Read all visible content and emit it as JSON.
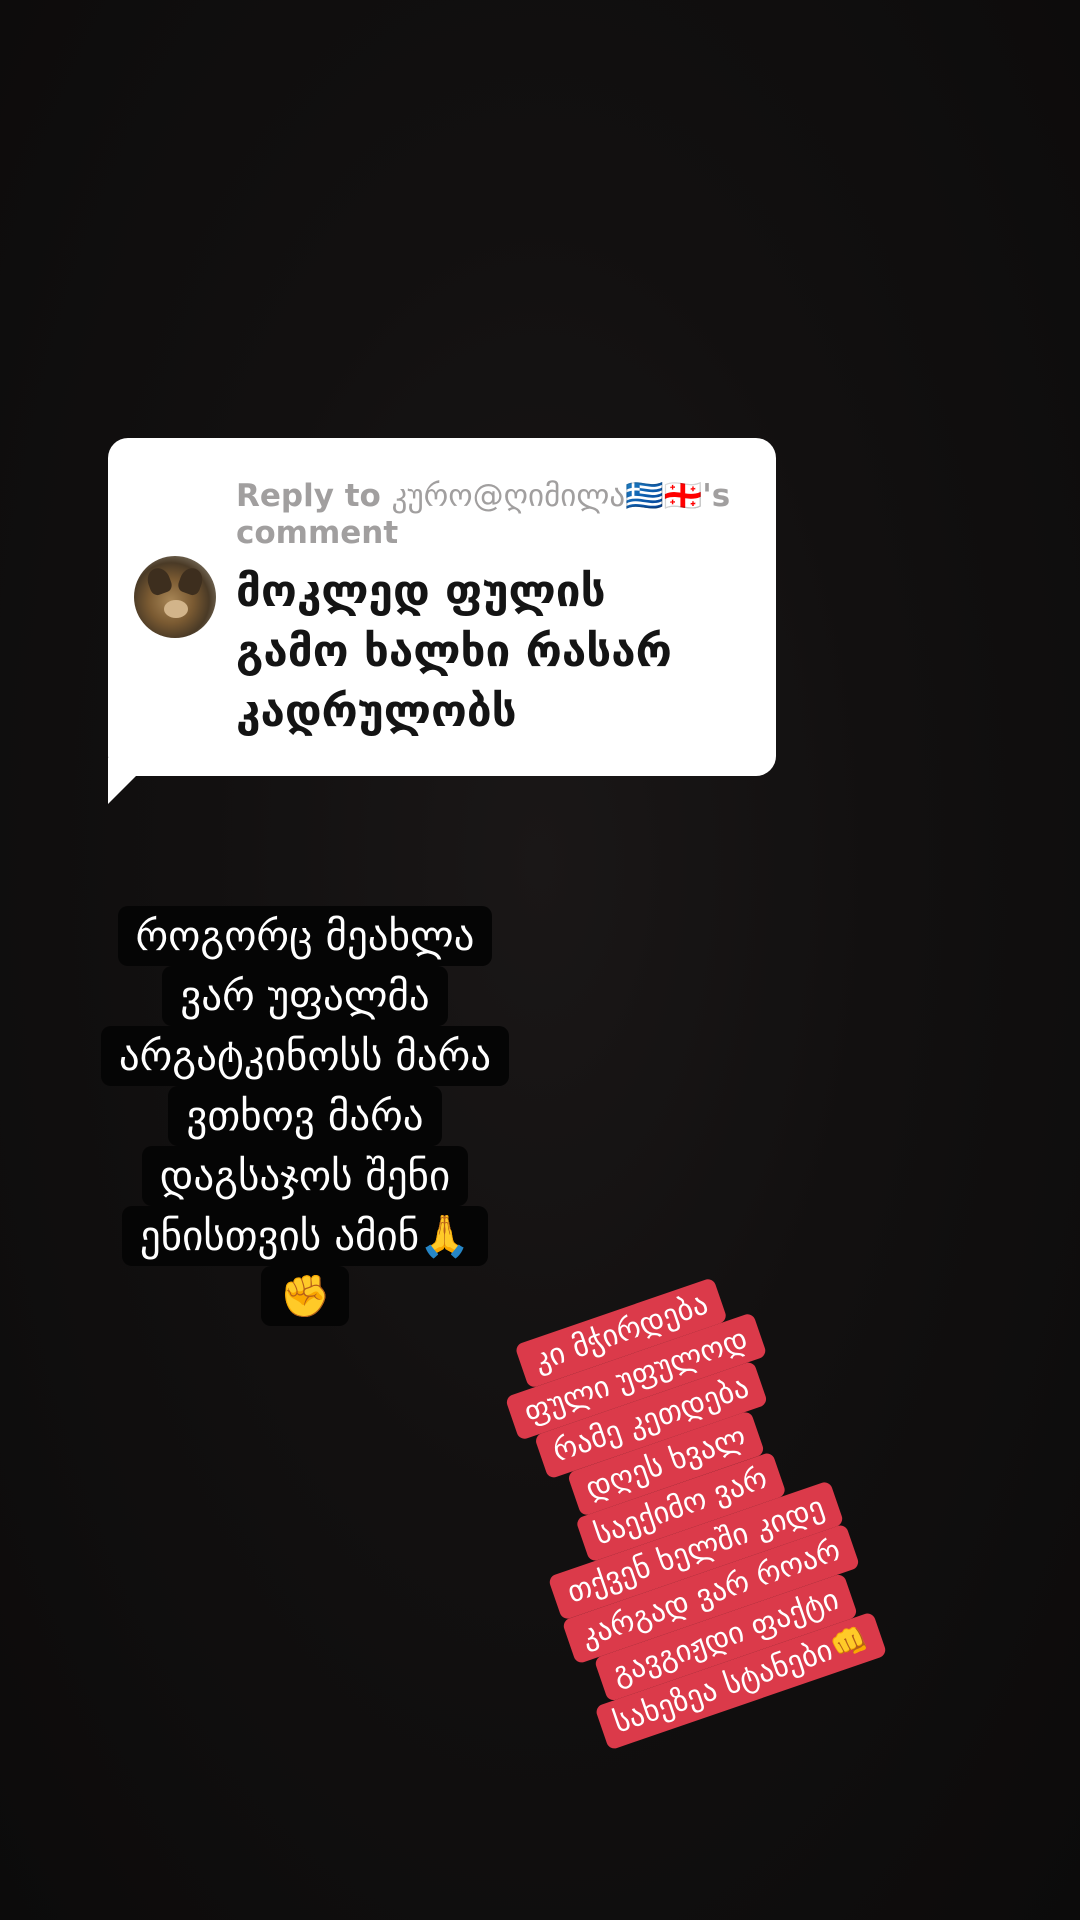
{
  "reply": {
    "prefix": "Reply to",
    "username": "კურო@ღიმილა🇬🇷🇬🇪",
    "suffix": "'s",
    "suffix2": "comment",
    "comment_lines": [
      "მოკლედ ფულის",
      "გამო ხალხი რასარ",
      "კადრულობს"
    ]
  },
  "caption": {
    "lines": [
      "როგორც მეახლა",
      "ვარ უფალმა",
      "არგატკინოსს მარა",
      "ვთხოვ მარა",
      "დაგსაჯოს შენი",
      "ენისთვის  ამინ🙏",
      "✊"
    ]
  },
  "red_caption": {
    "lines": [
      "კი მჭირდება",
      "ფული უფულოდ",
      "რამე კეთდება",
      "დღეს ხვალ",
      "საექიმო ვარ",
      "თქვენ ხელში კიდე",
      "კარგად ვარ როარ",
      "გავგიჟდი ფაქტი",
      "სახეზეა სტანები👊"
    ]
  },
  "colors": {
    "background": "#0f0d0d",
    "bubble": "#ffffff",
    "red_box": "#db3a4a",
    "black_box": "#050505"
  }
}
